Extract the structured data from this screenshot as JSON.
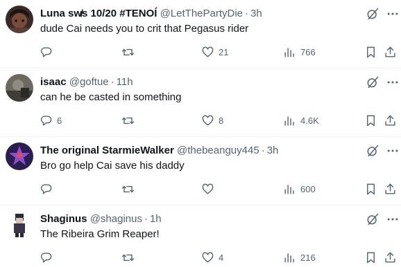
{
  "colors": {
    "text": "#0f1419",
    "muted": "#536471",
    "divider": "#eff3f4"
  },
  "icons": [
    "reply-icon",
    "retweet-icon",
    "like-icon",
    "views-icon",
    "bookmark-icon",
    "share-icon",
    "grok-icon",
    "more-icon"
  ],
  "posts": [
    {
      "name": "Luna    sw̸s 10/20 #TENOÍ",
      "handle": "@LetThePartyDie",
      "time": "3h",
      "text": "dude Cai needs you to crit that Pegasus rider",
      "replies": "",
      "retweets": "",
      "likes": "21",
      "views": "766"
    },
    {
      "name": "isaac",
      "handle": "@goftue",
      "time": "11h",
      "text": "can he be casted in something",
      "replies": "6",
      "retweets": "",
      "likes": "8",
      "views": "4.6K"
    },
    {
      "name": "The original StarmieWalker",
      "handle": "@thebeanguy445",
      "time": "3h",
      "text": "Bro go help Cai save his daddy",
      "replies": "",
      "retweets": "",
      "likes": "",
      "views": "600"
    },
    {
      "name": "Shaginus",
      "handle": "@shaginus",
      "time": "1h",
      "text": "The Ribeira Grim Reaper!",
      "replies": "",
      "retweets": "",
      "likes": "4",
      "views": "216"
    }
  ]
}
